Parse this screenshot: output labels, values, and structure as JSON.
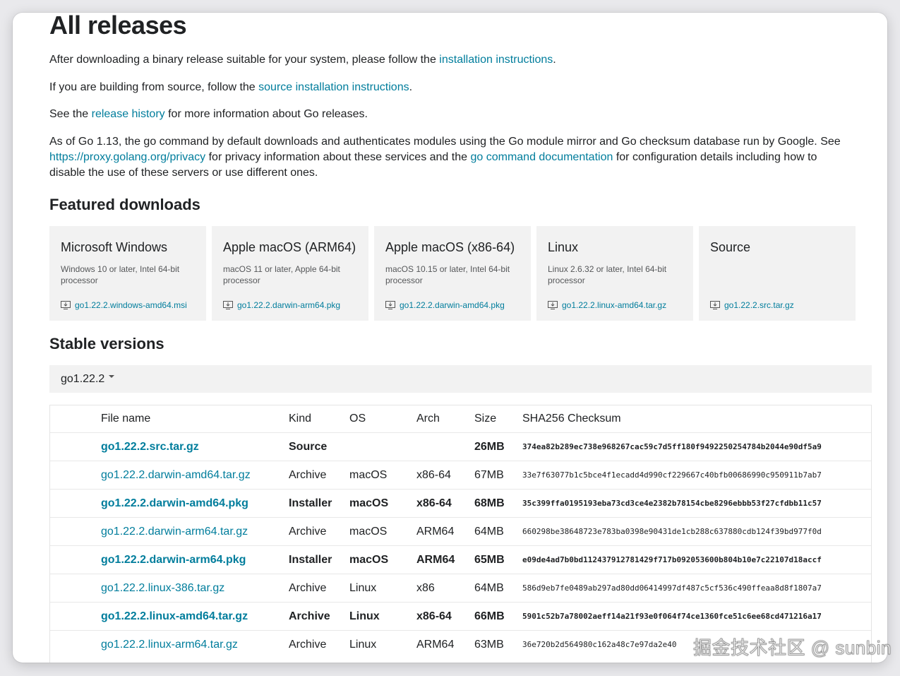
{
  "page": {
    "title": "All releases",
    "intro": [
      {
        "before": "After downloading a binary release suitable for your system, please follow the ",
        "link": "installation instructions",
        "after": "."
      },
      {
        "before": "If you are building from source, follow the ",
        "link": "source installation instructions",
        "after": "."
      },
      {
        "before": "See the ",
        "link": "release history",
        "after": " for more information about Go releases."
      }
    ],
    "privacy": {
      "p1": "As of Go 1.13, the go command by default downloads and authenticates modules using the Go module mirror and Go checksum database run by Google. See",
      "link1": "https://proxy.golang.org/privacy",
      "p2": " for privacy information about these services and the ",
      "link2": "go command documentation",
      "p3": " for configuration details including how to",
      "p4": "disable the use of these servers or use different ones."
    }
  },
  "featured": {
    "heading": "Featured downloads",
    "cards": [
      {
        "title": "Microsoft Windows",
        "desc": "Windows 10 or later, Intel 64-bit processor",
        "file": "go1.22.2.windows-amd64.msi"
      },
      {
        "title": "Apple macOS (ARM64)",
        "desc": "macOS 11 or later, Apple 64-bit processor",
        "file": "go1.22.2.darwin-arm64.pkg"
      },
      {
        "title": "Apple macOS (x86-64)",
        "desc": "macOS 10.15 or later, Intel 64-bit processor",
        "file": "go1.22.2.darwin-amd64.pkg"
      },
      {
        "title": "Linux",
        "desc": "Linux 2.6.32 or later, Intel 64-bit processor",
        "file": "go1.22.2.linux-amd64.tar.gz"
      },
      {
        "title": "Source",
        "desc": "",
        "file": "go1.22.2.src.tar.gz"
      }
    ]
  },
  "stable": {
    "heading": "Stable versions",
    "version": "go1.22.2",
    "columns": [
      "File name",
      "Kind",
      "OS",
      "Arch",
      "Size",
      "SHA256 Checksum"
    ],
    "rows": [
      {
        "file": "go1.22.2.src.tar.gz",
        "kind": "Source",
        "os": "",
        "arch": "",
        "size": "26MB",
        "sha": "374ea82b289ec738e968267cac59c7d5ff180f9492250254784b2044e90df5a9",
        "featured": true
      },
      {
        "file": "go1.22.2.darwin-amd64.tar.gz",
        "kind": "Archive",
        "os": "macOS",
        "arch": "x86-64",
        "size": "67MB",
        "sha": "33e7f63077b1c5bce4f1ecadd4d990cf229667c40bfb00686990c950911b7ab7",
        "featured": false
      },
      {
        "file": "go1.22.2.darwin-amd64.pkg",
        "kind": "Installer",
        "os": "macOS",
        "arch": "x86-64",
        "size": "68MB",
        "sha": "35c399ffa0195193eba73cd3ce4e2382b78154cbe8296ebbb53f27cfdbb11c57",
        "featured": true
      },
      {
        "file": "go1.22.2.darwin-arm64.tar.gz",
        "kind": "Archive",
        "os": "macOS",
        "arch": "ARM64",
        "size": "64MB",
        "sha": "660298be38648723e783ba0398e90431de1cb288c637880cdb124f39bd977f0d",
        "featured": false
      },
      {
        "file": "go1.22.2.darwin-arm64.pkg",
        "kind": "Installer",
        "os": "macOS",
        "arch": "ARM64",
        "size": "65MB",
        "sha": "e09de4ad7b0bd112437912781429f717b092053600b804b10e7c22107d18accf",
        "featured": true
      },
      {
        "file": "go1.22.2.linux-386.tar.gz",
        "kind": "Archive",
        "os": "Linux",
        "arch": "x86",
        "size": "64MB",
        "sha": "586d9eb7fe0489ab297ad80dd06414997df487c5cf536c490ffeaa8d8f1807a7",
        "featured": false
      },
      {
        "file": "go1.22.2.linux-amd64.tar.gz",
        "kind": "Archive",
        "os": "Linux",
        "arch": "x86-64",
        "size": "66MB",
        "sha": "5901c52b7a78002aeff14a21f93e0f064f74ce1360fce51c6ee68cd471216a17",
        "featured": true
      },
      {
        "file": "go1.22.2.linux-arm64.tar.gz",
        "kind": "Archive",
        "os": "Linux",
        "arch": "ARM64",
        "size": "63MB",
        "sha": "36e720b2d564980c162a48c7e97da2e40",
        "featured": false
      }
    ]
  },
  "watermark": "掘金技术社区 @ sunbin",
  "colors": {
    "link": "#007d9c",
    "card_bg": "#f2f2f2"
  }
}
